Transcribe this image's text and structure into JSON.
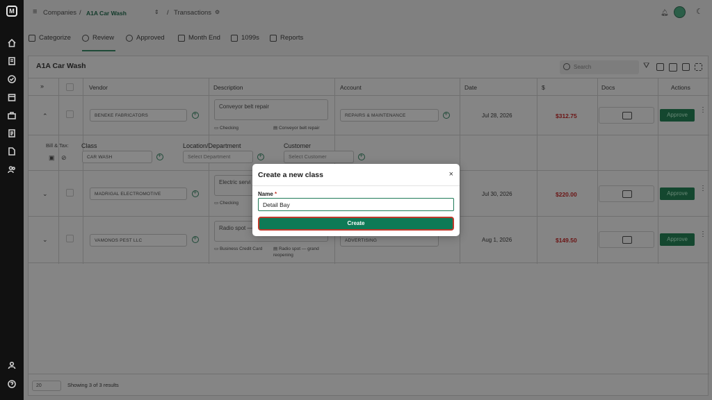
{
  "breadcrumb": {
    "root": "Companies",
    "company": "A1A Car Wash",
    "page": "Transactions",
    "separator": "/"
  },
  "tabs": [
    {
      "label": "Categorize"
    },
    {
      "label": "Review"
    },
    {
      "label": "Approved"
    },
    {
      "label": "Month End"
    },
    {
      "label": "1099s"
    },
    {
      "label": "Reports"
    }
  ],
  "panel": {
    "title": "A1A Car Wash",
    "search_placeholder": "Search"
  },
  "columns": {
    "vendor": "Vendor",
    "description": "Description",
    "account": "Account",
    "date": "Date",
    "amount": "$",
    "docs": "Docs",
    "actions": "Actions"
  },
  "rows": [
    {
      "vendor": "BENEKE FABRICATORS",
      "description": "Conveyor belt repair",
      "payment": "Checking",
      "memo": "Conveyor belt repair",
      "account": "REPAIRS & MAINTENANCE",
      "date": "Jul 28, 2026",
      "amount": "$312.75",
      "action": "Approve"
    },
    {
      "vendor": "MADRIGAL ELECTROMOTIVE",
      "description": "Electric servi",
      "payment": "Checking",
      "memo": "",
      "account": "",
      "date": "Jul 30, 2026",
      "amount": "$220.00",
      "action": "Approve"
    },
    {
      "vendor": "VAMONOS PEST LLC",
      "description": "Radio spot —",
      "payment": "Business Credit Card",
      "memo": "Radio spot — grand reopening",
      "account": "ADVERTISING",
      "date": "Aug 1, 2026",
      "amount": "$149.50",
      "action": "Approve"
    }
  ],
  "expanded": {
    "bill_tax_label": "Bill & Tax:",
    "class_label": "Class",
    "class_value": "CAR WASH",
    "location_label": "Location/Department",
    "location_placeholder": "Select Department",
    "customer_label": "Customer",
    "customer_placeholder": "Select Customer"
  },
  "footer": {
    "page_size": "20",
    "summary": "Showing 3 of 3 results"
  },
  "modal": {
    "title": "Create a new class",
    "close": "×",
    "name_label": "Name",
    "required_mark": "*",
    "name_value": "Detail Bay",
    "create_label": "Create"
  },
  "colors": {
    "accent": "#0e7a56",
    "amount": "#6b1414",
    "highlight": "#c0392b"
  }
}
